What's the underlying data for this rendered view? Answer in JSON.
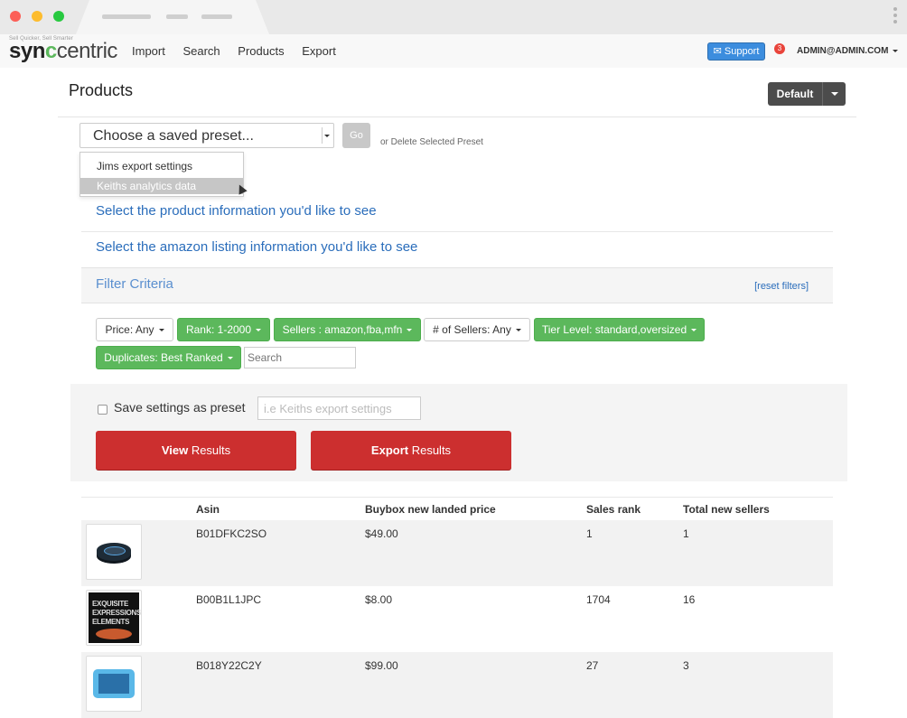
{
  "app": {
    "brand_tag": "Sell Quicker, Sell Smarter",
    "brand_sync": "syn",
    "brand_o": "c",
    "brand_centric": "centric",
    "colors": {
      "accent": "#3c8dde",
      "green": "#5cb85c",
      "red": "#cc2f2f",
      "link": "#2a6dbb"
    }
  },
  "nav": {
    "items": [
      "Import",
      "Search",
      "Products",
      "Export"
    ],
    "support_label": "Support",
    "notification_count": "3",
    "user_email": "ADMIN@ADMIN.COM"
  },
  "page": {
    "title": "Products",
    "default_label": "Default"
  },
  "preset": {
    "select_value": "Choose a saved preset...",
    "go_label": "Go",
    "delete_text": "or Delete Selected Preset",
    "options": [
      "Jims export settings",
      "Keiths analytics data"
    ]
  },
  "sections": {
    "product_info": "Select the product information you'd like to see",
    "amazon_info": "Select the amazon listing information you'd like to see",
    "filter_title": "Filter Criteria",
    "reset_link": "[reset filters]"
  },
  "filters": {
    "price": "Price: Any",
    "rank": "Rank: 1-2000",
    "sellers": "Sellers : amazon,fba,mfn",
    "num_sellers": "# of Sellers: Any",
    "tier": "Tier Level: standard,oversized",
    "duplicates": "Duplicates: Best Ranked",
    "search_placeholder": "Search"
  },
  "save": {
    "label": "Save settings as preset",
    "placeholder": "i.e Keiths export settings",
    "view_bold": "View",
    "view_rest": " Results",
    "export_bold": "Export",
    "export_rest": " Results"
  },
  "table": {
    "columns": [
      "Asin",
      "Buybox new landed price",
      "Sales rank",
      "Total new sellers"
    ],
    "rows": [
      {
        "asin": "B01DFKC2SO",
        "price": "$49.00",
        "rank": "1",
        "sellers": "1",
        "thumb": "echo-dot-icon"
      },
      {
        "asin": "B00B1L1JPC",
        "price": "$8.00",
        "rank": "1704",
        "sellers": "16",
        "thumb": "book-cover-icon",
        "book_lines": [
          "EXQUISITE",
          "EXPRESSIONS",
          "ELEMENTS"
        ]
      },
      {
        "asin": "B018Y22C2Y",
        "price": "$99.00",
        "rank": "27",
        "sellers": "3",
        "thumb": "kids-tablet-icon"
      }
    ]
  }
}
